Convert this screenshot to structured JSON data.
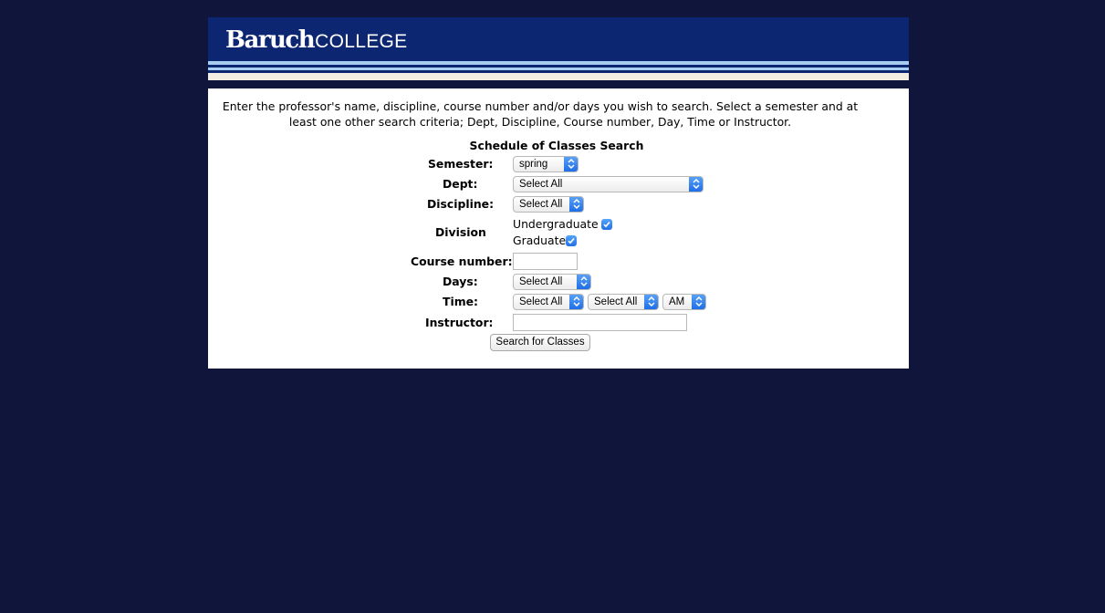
{
  "header": {
    "logo_primary": "Baruch",
    "logo_secondary": "COLLEGE"
  },
  "intro_text": "Enter the professor's name, discipline, course number and/or days you wish to search. Select a semester and at least one other search criteria; Dept, Discipline, Course number, Day, Time or Instructor.",
  "form": {
    "title": "Schedule of Classes Search",
    "semester": {
      "label": "Semester:",
      "value": "spring"
    },
    "dept": {
      "label": "Dept:",
      "value": "Select All"
    },
    "discipline": {
      "label": "Discipline:",
      "value": "Select All"
    },
    "division": {
      "label": "Division",
      "options": [
        {
          "label": "Undergraduate",
          "checked": true
        },
        {
          "label": "Graduate",
          "checked": true
        }
      ]
    },
    "course_number": {
      "label": "Course number:",
      "value": ""
    },
    "days": {
      "label": "Days:",
      "value": "Select All"
    },
    "time": {
      "label": "Time:",
      "hour": "Select All",
      "minute": "Select All",
      "ampm": "AM"
    },
    "instructor": {
      "label": "Instructor:",
      "value": ""
    },
    "submit_label": "Search for Classes"
  },
  "colors": {
    "page_background": "#10153c",
    "banner": "#0c2672",
    "stripe_light_blue": "#a9cdf0",
    "stripe_cream": "#f2ede2",
    "control_accent": "#1b6be6"
  }
}
